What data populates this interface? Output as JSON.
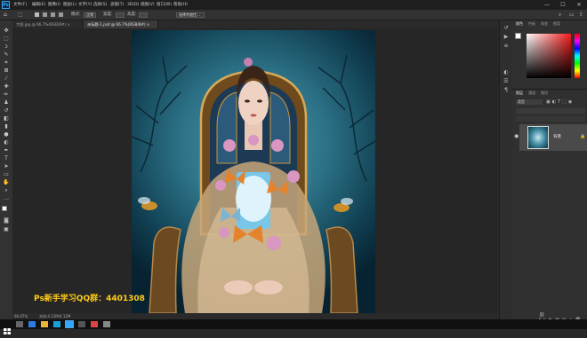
{
  "menubar": {
    "logo": "Ps",
    "items": [
      "文件(F)",
      "编辑(E)",
      "图像(I)",
      "图层(L)",
      "文字(Y)",
      "选择(S)",
      "滤镜(T)",
      "3D(D)",
      "视图(V)",
      "窗口(W)",
      "帮助(H)"
    ],
    "window_controls": [
      "—",
      "☐",
      "✕"
    ]
  },
  "optbar": {
    "style_label": "模式:",
    "style_value": "正常",
    "opacity_label": "宽度:",
    "height_label": "高度:",
    "mask_button": "选择并遮住..."
  },
  "tabs": [
    {
      "label": "大图.jpg @ 66.7%(RGB/8#) ×",
      "active": false
    },
    {
      "label": "未标题-1.psd @ 66.7%(RGB/8#) ×",
      "active": true
    }
  ],
  "statusbar": {
    "zoom": "66.67%",
    "doc_info": "文档:4.12M/4.12M"
  },
  "overlay": {
    "qq_text": "Ps新手学习QQ群：4401308"
  },
  "panels": {
    "color_tabs": [
      "颜色",
      "色板",
      "渐变",
      "图案"
    ],
    "layers_tabs": [
      "图层",
      "通道",
      "路径"
    ],
    "layer_search_placeholder": "类型",
    "layer_name": "背景",
    "fg_color": "#ffffff",
    "bg_color": "#000000"
  },
  "taskbar": {
    "start_icon": "windows-start-icon"
  }
}
